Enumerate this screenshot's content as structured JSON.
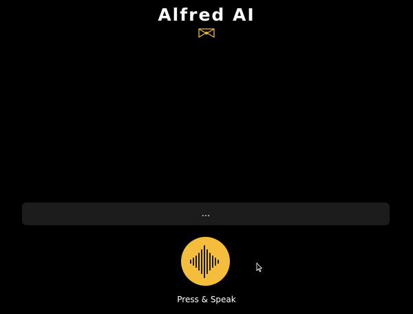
{
  "app": {
    "title": "Alfred AI",
    "logo_icon": "bowtie-icon",
    "accent_color": "#f4bd3b"
  },
  "transcript": {
    "text": "..."
  },
  "speak_button": {
    "icon": "waveform-icon",
    "label": "Press & Speak"
  }
}
